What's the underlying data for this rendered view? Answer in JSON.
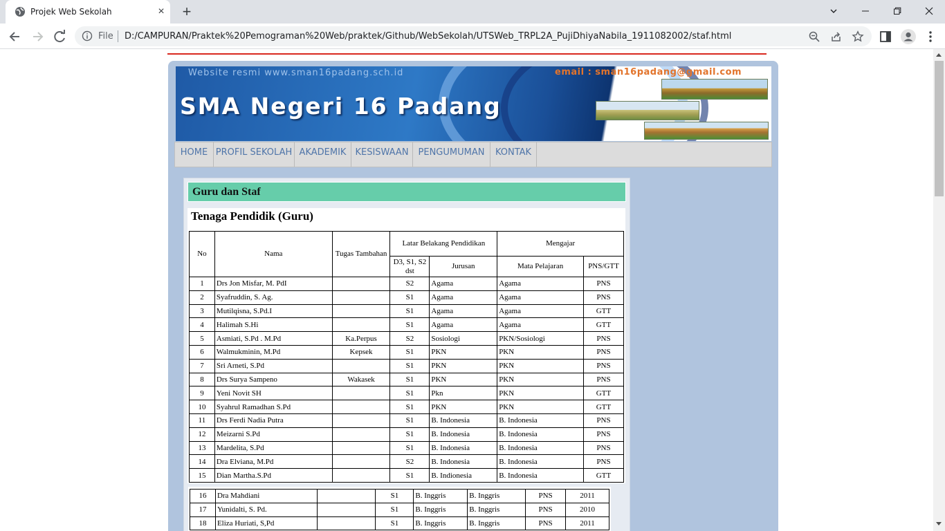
{
  "browser": {
    "tab_title": "Projek Web Sekolah",
    "new_tab_glyph": "+",
    "close_glyph": "×",
    "url_scheme_label": "File",
    "url": "D:/CAMPURAN/Praktek%20Pemograman%20Web/praktek/Github/WebSekolah/UTSWeb_TRPL2A_PujiDhiyaNabila_1911082002/staf.html",
    "icons": [
      "globe-icon",
      "back-icon",
      "forward-icon",
      "reload-icon",
      "info-icon",
      "zoom-icon",
      "share-icon",
      "star-icon",
      "side-panel-icon",
      "profile-icon",
      "menu-icon",
      "minimize-icon",
      "restore-icon",
      "close-icon"
    ]
  },
  "site": {
    "banner": {
      "website_text": "Website resmi www.sman16padang.sch.id",
      "email_text": "email : sman16padang@gmail.com",
      "title": "SMA Negeri 16 Padang"
    },
    "menu": [
      "HOME",
      "PROFIL SEKOLAH",
      "AKADEMIK",
      "KESISWAAN",
      "PENGUMUMAN",
      "KONTAK"
    ],
    "link_color": "#4f75a9",
    "heading_color": "#66cdaa"
  },
  "content": {
    "heading": "Guru dan Staf",
    "table_title": "Tenaga Pendidik (Guru)",
    "headers": {
      "no": "No",
      "nama": "Nama",
      "tugas": "Tugas Tambahan",
      "latar": "Latar Belakang Pendidikan",
      "mengajar": "Mengajar",
      "jenjang": "D3, S1, S2 dst",
      "jurusan": "Jurusan",
      "mapel": "Mata Pelajaran",
      "status": "PNS/GTT"
    },
    "rows": [
      {
        "no": "1",
        "nama": "Drs Jon Misfar, M. PdI",
        "tugas": "",
        "jenjang": "S2",
        "jurusan": "Agama",
        "mapel": "Agama",
        "status": "PNS"
      },
      {
        "no": "2",
        "nama": "Syafruddin, S. Ag.",
        "tugas": "",
        "jenjang": "S1",
        "jurusan": "Agama",
        "mapel": "Agama",
        "status": "PNS"
      },
      {
        "no": "3",
        "nama": "Mutilqisna, S.Pd.I",
        "tugas": "",
        "jenjang": "S1",
        "jurusan": "Agama",
        "mapel": "Agama",
        "status": "GTT"
      },
      {
        "no": "4",
        "nama": "Halimah S.Hi",
        "tugas": "",
        "jenjang": "S1",
        "jurusan": "Agama",
        "mapel": "Agama",
        "status": "GTT"
      },
      {
        "no": "5",
        "nama": "Asmiati, S.Pd . M.Pd",
        "tugas": "Ka.Perpus",
        "jenjang": "S2",
        "jurusan": "Sosiologi",
        "mapel": "PKN/Sosiologi",
        "status": "PNS"
      },
      {
        "no": "6",
        "nama": "Walmukminin, M.Pd",
        "tugas": "Kepsek",
        "jenjang": "S1",
        "jurusan": "PKN",
        "mapel": "PKN",
        "status": "PNS"
      },
      {
        "no": "7",
        "nama": "Sri Arneti, S.Pd",
        "tugas": "",
        "jenjang": "S1",
        "jurusan": "PKN",
        "mapel": "PKN",
        "status": "PNS"
      },
      {
        "no": "8",
        "nama": "Drs Surya Sampeno",
        "tugas": "Wakasek",
        "jenjang": "S1",
        "jurusan": "PKN",
        "mapel": "PKN",
        "status": "PNS"
      },
      {
        "no": "9",
        "nama": "Yeni Novit SH",
        "tugas": "",
        "jenjang": "S1",
        "jurusan": "Pkn",
        "mapel": "PKN",
        "status": "GTT"
      },
      {
        "no": "10",
        "nama": "Syahrul Ramadhan S.Pd",
        "tugas": "",
        "jenjang": "S1",
        "jurusan": "PKN",
        "mapel": "PKN",
        "status": "GTT"
      },
      {
        "no": "11",
        "nama": "Drs Ferdi Nadia Putra",
        "tugas": "",
        "jenjang": "S1",
        "jurusan": "B. Indonesia",
        "mapel": "B. Indonesia",
        "status": "PNS"
      },
      {
        "no": "12",
        "nama": "Meizarni S.Pd",
        "tugas": "",
        "jenjang": "S1",
        "jurusan": "B. Indonesia",
        "mapel": "B. Indonesia",
        "status": "PNS"
      },
      {
        "no": "13",
        "nama": "Mardelita, S.Pd",
        "tugas": "",
        "jenjang": "S1",
        "jurusan": "B. Indonesia",
        "mapel": "B. Indonesia",
        "status": "PNS"
      },
      {
        "no": "14",
        "nama": "Dra Elviana, M.Pd",
        "tugas": "",
        "jenjang": "S2",
        "jurusan": "B. Indonesia",
        "mapel": "B. Indonesia",
        "status": "PNS"
      },
      {
        "no": "15",
        "nama": "Dian Martha.S.Pd",
        "tugas": "",
        "jenjang": "S1",
        "jurusan": "B. Indionesia",
        "mapel": "B. Indonesia",
        "status": "GTT"
      }
    ],
    "rows2": [
      {
        "no": "16",
        "nama": "Dra Mahdiani",
        "tugas": "",
        "jenjang": "S1",
        "jurusan": "B. Inggris",
        "mapel": "B. Inggris",
        "status": "PNS",
        "tahun": "2011"
      },
      {
        "no": "17",
        "nama": "Yunidalti, S. Pd.",
        "tugas": "",
        "jenjang": "S1",
        "jurusan": "B. Inggris",
        "mapel": "B. Inggris",
        "status": "PNS",
        "tahun": "2010"
      },
      {
        "no": "18",
        "nama": "Eliza Huriati, S,Pd",
        "tugas": "",
        "jenjang": "S1",
        "jurusan": "B. Inggris",
        "mapel": "B. Inggris",
        "status": "PNS",
        "tahun": "2011"
      }
    ]
  }
}
